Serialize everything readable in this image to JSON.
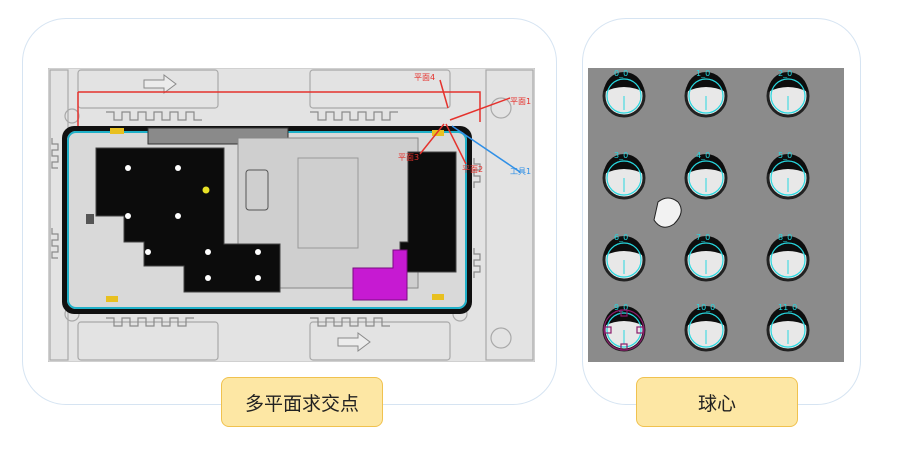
{
  "left_panel": {
    "caption": "多平面求交点",
    "annotations": {
      "plane1": "平面1",
      "plane2": "平面2",
      "plane3": "平面3",
      "plane4": "平面4",
      "tool": "工具1"
    }
  },
  "right_panel": {
    "caption": "球心",
    "ball_labels": [
      "0_0",
      "1_0",
      "2_0",
      "3_0",
      "4_0",
      "5_0",
      "6_0",
      "7_0",
      "8_0",
      "9_0",
      "10_0",
      "11_0"
    ]
  },
  "colors": {
    "red": "#e5322d",
    "blue": "#2f8fe6",
    "cyan": "#27d8e0",
    "magenta": "#c61ad2",
    "yellow": "#e8e226",
    "caption_bg": "#fde7a4"
  }
}
